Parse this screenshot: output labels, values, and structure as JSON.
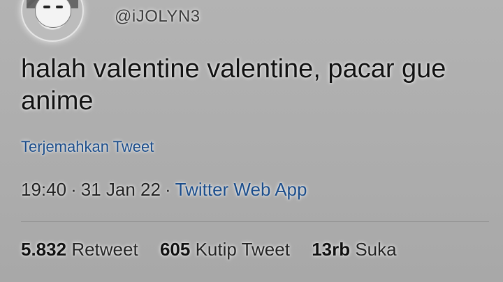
{
  "author": {
    "handle": "@iJOLYN3"
  },
  "tweet": {
    "text": "halah valentine valentine, pacar gue anime",
    "translate_link": "Terjemahkan Tweet",
    "time": "19:40",
    "date": "31 Jan 22",
    "separator": "·",
    "source": "Twitter Web App"
  },
  "stats": [
    {
      "count": "5.832",
      "label": "Retweet"
    },
    {
      "count": "605",
      "label": "Kutip Tweet"
    },
    {
      "count": "13rb",
      "label": "Suka"
    }
  ],
  "colors": {
    "background": "#a9a9a9",
    "link": "#1a4c8a",
    "text": "#111111"
  }
}
